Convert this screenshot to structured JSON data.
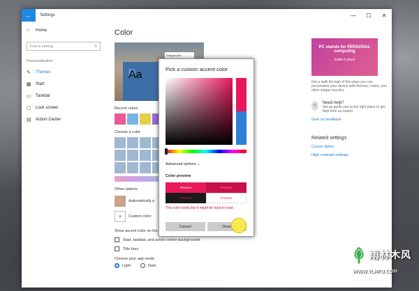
{
  "window": {
    "title": "Settings",
    "back_icon": "back-arrow-icon",
    "minimize": "—",
    "maximize": "☐",
    "close": "✕"
  },
  "nav": {
    "home": "Home",
    "search_placeholder": "Find a setting",
    "section": "Personalization",
    "items": [
      {
        "label": "Themes",
        "icon": "paintbrush-icon"
      },
      {
        "label": "Start",
        "icon": "start-icon"
      },
      {
        "label": "Taskbar",
        "icon": "taskbar-icon"
      },
      {
        "label": "Lock screen",
        "icon": "lock-screen-icon"
      },
      {
        "label": "Action Center",
        "icon": "action-center-icon"
      }
    ]
  },
  "main": {
    "title": "Color",
    "sample_text": "Sample text",
    "preview_tile": "Aa",
    "recent_colors": "Recent colors",
    "choose_color": "Choose a color",
    "other_options": "Other options",
    "automatic": "Automatically p",
    "custom_color": "Custom color",
    "show_accent": "Show accent color on the following surfaces",
    "start_taskbar": "Start, taskbar, and action center backgrounds",
    "title_bars": "Title bars",
    "app_mode": "Choose your app mode",
    "light": "Light",
    "dark": "Dark",
    "recent_swatches": [
      "#e85a9a",
      "#78b4e6",
      "#e6d04a",
      "#9a6ad6",
      "#4aa0d6"
    ],
    "palette_colors": [
      "#a0b8d0",
      "#a0b8d0",
      "#a0b8d0",
      "#a0b8d0",
      "#a0b8d0",
      "#a0b8d0",
      "#a0b8d0",
      "#a0b8d0",
      "#a0b8d0",
      "#a0b8d0",
      "#a0b8d0",
      "#a0b8d0",
      "#a0b8d0",
      "#a0b8d0",
      "#a0b8d0",
      "#a0b8d0",
      "#a0b8d0",
      "#a0b8d0"
    ]
  },
  "right": {
    "promo_title": "PC stands for PERSONAL computing",
    "promo_sub": "make it yours",
    "promo_desc": "Get a walk through of the ways you can personalize your device with themes, colors, and other unique touches",
    "need_help": "Need help?",
    "help_desc": "Set up guide you to the right place to get help from an expert",
    "feedback": "Give us feedback",
    "related": "Related settings",
    "cursor_styles": "Cursor styles",
    "high_contrast": "High contrast settings"
  },
  "dialog": {
    "title": "Pick a custom accent color",
    "advanced": "Advanced options",
    "preview_label": "Color preview",
    "preview_cells": [
      "Preview",
      "Preview",
      "Preview",
      "Preview"
    ],
    "warning": "This color looks like it might be hard to read.",
    "cancel": "Cancel",
    "done": "Done",
    "colors": {
      "accent": "#e8185a",
      "alt": "#2f7ed8"
    }
  },
  "watermark": {
    "brand": "雨林木风",
    "url": "WWW.YLMFU.COM"
  }
}
